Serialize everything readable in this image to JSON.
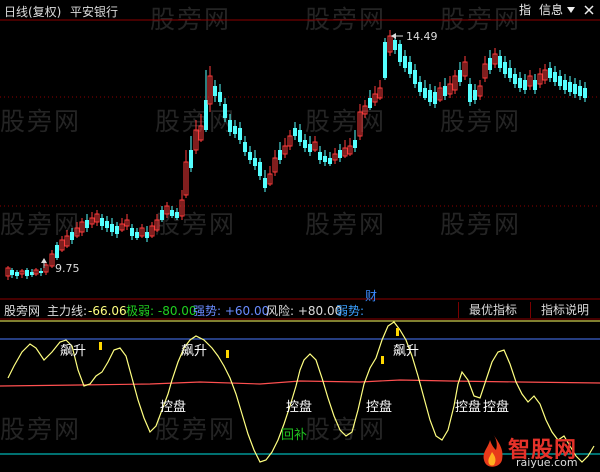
{
  "header": {
    "period": "日线(复权)",
    "stock_name": "平安银行",
    "buttons": [
      {
        "label": "指",
        "icon": ""
      },
      {
        "label": "信息",
        "icon": ""
      },
      {
        "label": "",
        "icon": "down-triangle-icon"
      },
      {
        "label": "",
        "icon": "close-icon"
      }
    ]
  },
  "watermark": "股旁网",
  "price_annotations": {
    "high": "14.49",
    "low": "9.75"
  },
  "marker_label": "财",
  "indicator_bar": {
    "source": "股旁网",
    "main_line_label": "主力线:",
    "main_line_value": "-66.06",
    "extreme_weak": "极弱: -80.00",
    "strong_trend": "强势: +60.00",
    "risk": "风险: +80.00",
    "weak_trend": "弱势: ",
    "tabs": [
      "最优指标",
      "指标说明"
    ]
  },
  "signals": {
    "rise": "飙升",
    "control": "控盘",
    "rebound": "回补"
  },
  "logo": {
    "text": "智股网",
    "url_text": "raiyue.com"
  },
  "colors": {
    "up": "#ff3c3c",
    "down": "#54ffff",
    "grid_red": "#8b0000",
    "main_line": "#ffff80",
    "risk_line": "#ff5050",
    "strong_line": "#4a7aff",
    "extreme_line": "#00e0e0",
    "weak_text": "#3aa0ff",
    "gold": "#ffd700"
  }
}
